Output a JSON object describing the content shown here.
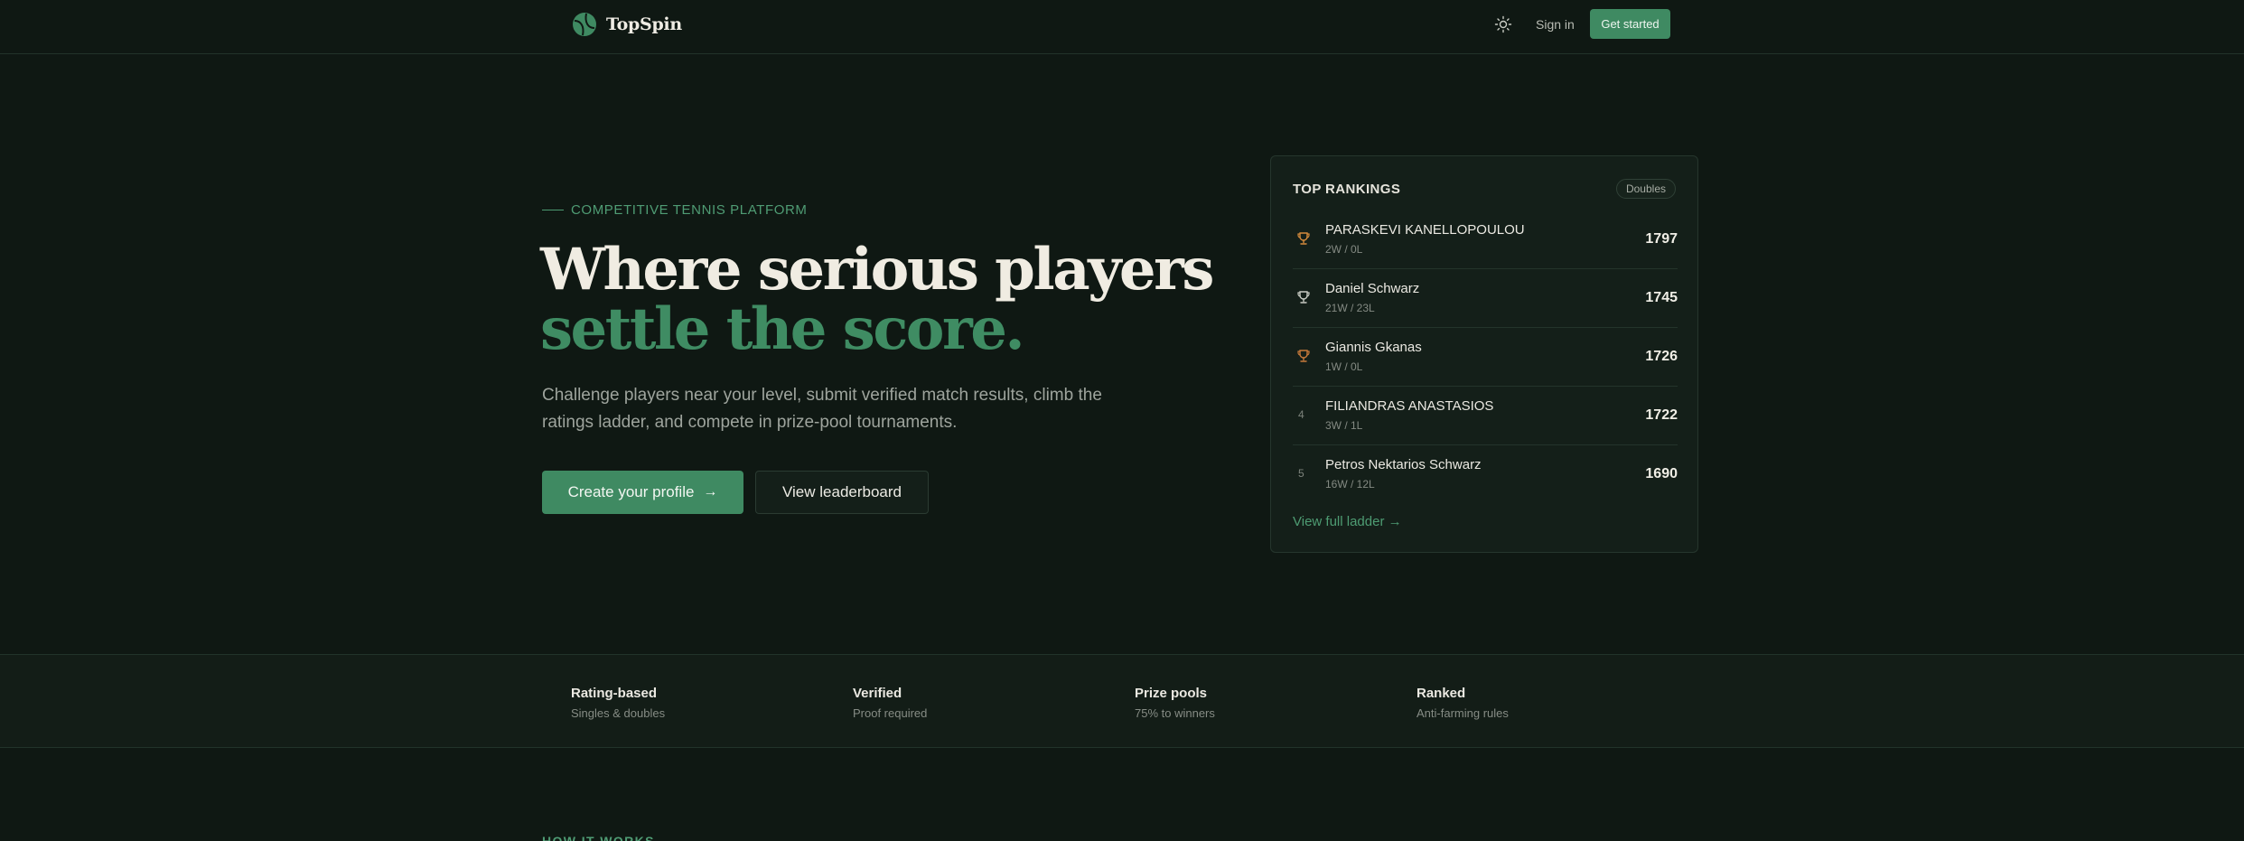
{
  "header": {
    "brand_name": "TopSpin",
    "logo_icon": "tennis-ball-logo",
    "theme_icon": "sun-icon",
    "sign_in": "Sign in",
    "get_started": "Get started"
  },
  "hero": {
    "eyebrow": "COMPETITIVE TENNIS PLATFORM",
    "headline_line1": "Where serious players",
    "headline_line2": "settle the score.",
    "subhead": "Challenge players near your level, submit verified match results, climb the ratings ladder, and compete in prize-pool tournaments.",
    "primary_cta": "Create your profile",
    "primary_cta_icon": "arrow-right-icon",
    "secondary_cta": "View leaderboard"
  },
  "rankings": {
    "title": "TOP RANKINGS",
    "badge": "Doubles",
    "rows": [
      {
        "rank": "1",
        "icon": "trophy-icon",
        "name": "PARASKEVI KANELLOPOULOU",
        "record": "2W / 0L",
        "rating": "1797"
      },
      {
        "rank": "2",
        "icon": "trophy-icon",
        "name": "Daniel Schwarz",
        "record": "21W / 23L",
        "rating": "1745"
      },
      {
        "rank": "3",
        "icon": "trophy-icon",
        "name": "Giannis Gkanas",
        "record": "1W / 0L",
        "rating": "1726"
      },
      {
        "rank": "4",
        "icon": "",
        "name": "FILIANDRAS ANASTASIOS",
        "record": "3W / 1L",
        "rating": "1722"
      },
      {
        "rank": "5",
        "icon": "",
        "name": "Petros Nektarios Schwarz",
        "record": "16W / 12L",
        "rating": "1690"
      }
    ],
    "link": "View full ladder →"
  },
  "features": [
    {
      "title": "Rating-based",
      "sub": "Singles & doubles"
    },
    {
      "title": "Verified",
      "sub": "Proof required"
    },
    {
      "title": "Prize pools",
      "sub": "75% to winners"
    },
    {
      "title": "Ranked",
      "sub": "Anti-farming rules"
    }
  ],
  "next_section": {
    "eyebrow": "HOW IT WORKS"
  },
  "colors": {
    "background": "#0f1813",
    "accent": "#3f8a62",
    "card": "#141f19",
    "trophy": "#d48a3c"
  }
}
